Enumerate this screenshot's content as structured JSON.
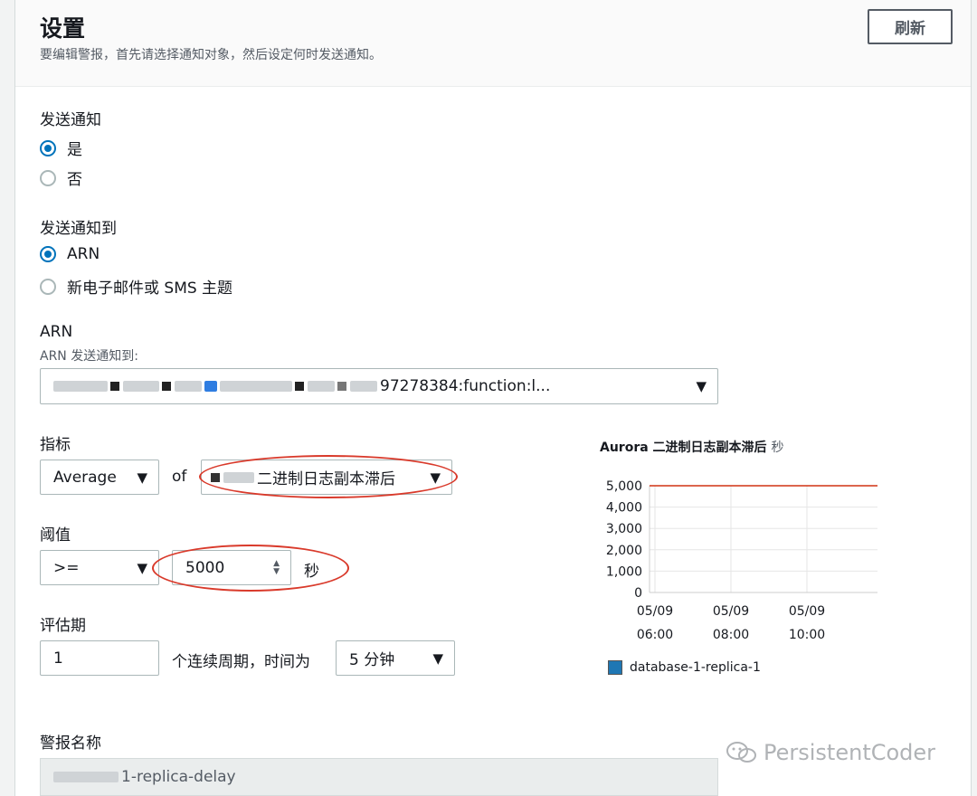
{
  "header": {
    "title": "设置",
    "description": "要编辑警报，首先请选择通知对象，然后设定何时发送通知。",
    "refresh_label": "刷新"
  },
  "send_notification": {
    "label": "发送通知",
    "options": [
      {
        "label": "是",
        "checked": true
      },
      {
        "label": "否",
        "checked": false
      }
    ]
  },
  "send_to": {
    "label": "发送通知到",
    "options": [
      {
        "label": "ARN",
        "checked": true
      },
      {
        "label": "新电子邮件或 SMS 主题",
        "checked": false
      }
    ]
  },
  "arn": {
    "label": "ARN",
    "sublabel": "ARN 发送通知到:",
    "value_visible": "97278384:function:l..."
  },
  "metric": {
    "label": "指标",
    "statistic": "Average",
    "of_text": "of",
    "name": "二进制日志副本滞后"
  },
  "threshold": {
    "label": "阈值",
    "operator": ">=",
    "value": "5000",
    "unit": "秒"
  },
  "evaluation": {
    "label": "评估期",
    "periods": "1",
    "middle_text": "个连续周期，时间为",
    "period": "5 分钟"
  },
  "alarm_name": {
    "label": "警报名称",
    "value_visible": "1-replica-delay"
  },
  "chart_data": {
    "type": "line",
    "title": "Aurora 二进制日志副本滞后",
    "unit": "秒",
    "ylim": [
      0,
      5000
    ],
    "yticks": [
      "5,000",
      "4,000",
      "3,000",
      "2,000",
      "1,000",
      "0"
    ],
    "xticks": [
      {
        "date": "05/09",
        "time": "06:00"
      },
      {
        "date": "05/09",
        "time": "08:00"
      },
      {
        "date": "05/09",
        "time": "10:00"
      }
    ],
    "threshold": 5000,
    "threshold_color": "#d13212",
    "grid": true,
    "series": [
      {
        "name": "database-1-replica-1",
        "color": "#1f77b4",
        "values": []
      }
    ]
  },
  "watermark": "PersistentCoder"
}
